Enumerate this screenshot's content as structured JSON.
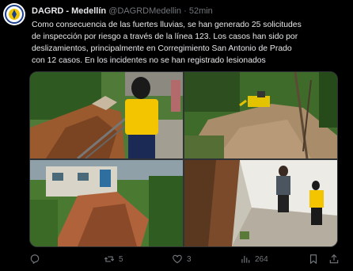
{
  "account": {
    "display_name": "DAGRD - Medellín",
    "handle": "@DAGRDMedellin",
    "separator": "·",
    "time": "52min"
  },
  "tweet": {
    "lines": [
      "Como consecuencia de las fuertes lluvias, se han generado 25 solicitudes",
      "de inspección por riesgo a través de la línea 123. Los casos han sido por",
      "deslizamientos, principalmente en Corregimiento San Antonio de Prado",
      "con 12 casos. En los incidentes no se han registrado lesionados"
    ]
  },
  "media": {
    "photos": [
      {
        "icon": "landslide-with-officer-photo"
      },
      {
        "icon": "excavator-on-muddy-road-photo"
      },
      {
        "icon": "collapsed-hillside-house-photo"
      },
      {
        "icon": "officers-inspecting-wall-photo"
      }
    ]
  },
  "actions": {
    "reply_count": "",
    "retweet_count": "5",
    "like_count": "3",
    "views_count": "264"
  },
  "colors": {
    "background": "#000000",
    "text_primary": "#e7e9ea",
    "text_secondary": "#71767b",
    "vest_yellow": "#f2c500",
    "soil": "#a0522d",
    "foliage": "#3f6b2a"
  }
}
